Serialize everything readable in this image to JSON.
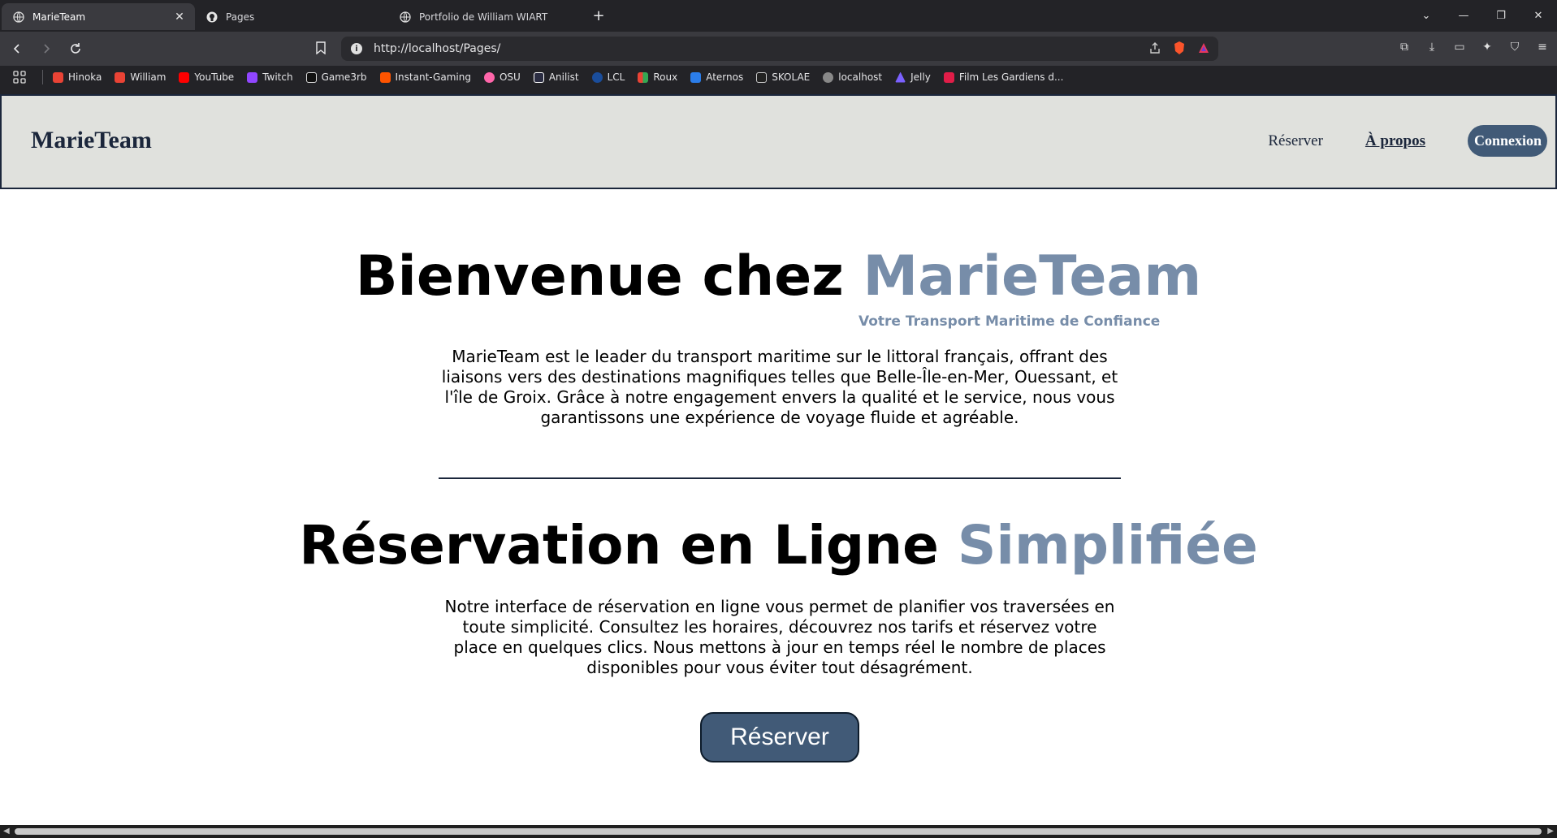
{
  "browser": {
    "tabs": [
      {
        "title": "MarieTeam",
        "active": true
      },
      {
        "title": "Pages",
        "active": false
      },
      {
        "title": "Portfolio de William WIART",
        "active": false
      }
    ],
    "url": "http://localhost/Pages/",
    "bookmarks": [
      {
        "label": "Hinoka",
        "color": "#ea4335"
      },
      {
        "label": "William",
        "color": "#ea4335"
      },
      {
        "label": "YouTube",
        "color": "#ff0000"
      },
      {
        "label": "Twitch",
        "color": "#9146ff"
      },
      {
        "label": "Game3rb",
        "color": "#ffffff"
      },
      {
        "label": "Instant-Gaming",
        "color": "#ff5400"
      },
      {
        "label": "OSU",
        "color": "#ff66aa"
      },
      {
        "label": "Anilist",
        "color": "#ffffff"
      },
      {
        "label": "LCL",
        "color": "#1a4d9b"
      },
      {
        "label": "Roux",
        "color": "#34a853"
      },
      {
        "label": "Aternos",
        "color": "#2b7de9"
      },
      {
        "label": "SKOLAE",
        "color": "#ffffff"
      },
      {
        "label": "localhost",
        "color": "#bbbbbb"
      },
      {
        "label": "Jelly",
        "color": "#7b61ff"
      },
      {
        "label": "Film Les Gardiens d...",
        "color": "#e11d48"
      }
    ]
  },
  "site": {
    "logo": "MarieTeam",
    "nav": {
      "reserve": "Réserver",
      "about": "À propos",
      "login": "Connexion"
    },
    "hero": {
      "title_main": "Bienvenue chez ",
      "title_accent": "MarieTeam",
      "tagline": "Votre Transport Maritime de Confiance",
      "paragraph": "MarieTeam est le leader du transport maritime sur le littoral français, offrant des liaisons vers des destinations magnifiques telles que Belle-Île-en-Mer, Ouessant, et l'île de Groix. Grâce à notre engagement envers la qualité et le service, nous vous garantissons une expérience de voyage fluide et agréable."
    },
    "booking": {
      "title_main": "Réservation en Ligne ",
      "title_accent": "Simplifiée",
      "paragraph": "Notre interface de réservation en ligne vous permet de planifier vos traversées en toute simplicité. Consultez les horaires, découvrez nos tarifs et réservez votre place en quelques clics. Nous mettons à jour en temps réel le nombre de places disponibles pour vous éviter tout désagrément.",
      "cta": "Réserver"
    }
  },
  "colors": {
    "header_bg": "#e0e1dd",
    "primary": "#1b263b",
    "accent": "#778da9",
    "button": "#415a77"
  }
}
